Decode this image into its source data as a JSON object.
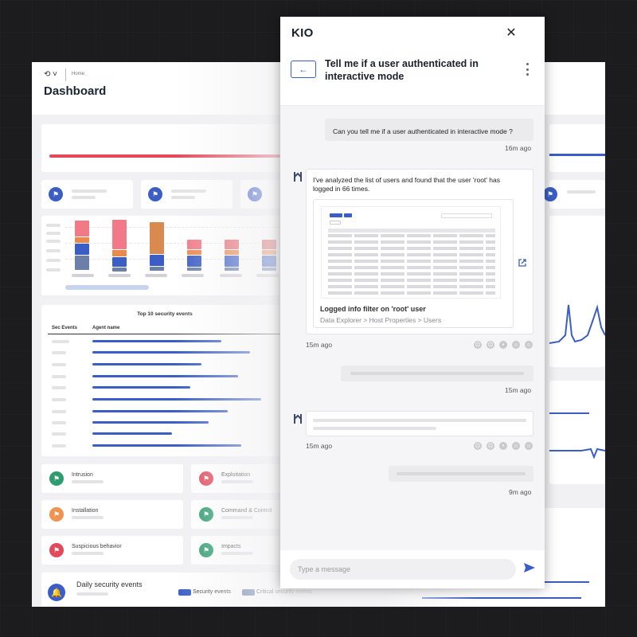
{
  "dashboard": {
    "breadcrumb": "Home",
    "title": "Dashboard",
    "top_events_title": "Top 10 security events",
    "col_sec_events": "Sec Events",
    "col_agent_name": "Agent name",
    "categories": [
      {
        "name": "Intrusion",
        "color": "#2e9c6e"
      },
      {
        "name": "Exploitation",
        "color": "#e24a5c"
      },
      {
        "name": "Installation",
        "color": "#ef9350"
      },
      {
        "name": "Command & Control",
        "color": "#2e9c6e"
      },
      {
        "name": "Suspicious behavior",
        "color": "#e24a5c"
      },
      {
        "name": "Impacts",
        "color": "#2e9c6e"
      }
    ],
    "daily_title": "Daily security events",
    "legend": [
      "Security events",
      "Critical security events"
    ],
    "legend_colors": [
      "#3b5ec6",
      "#6b7fa8"
    ]
  },
  "chat": {
    "app_name": "KIO",
    "conversation_title": "Tell me if a user authenticated in interactive mode",
    "user_message": "Can you tell me if a user authenticated in interactive mode ?",
    "user_message_time": "16m ago",
    "bot_message": "I've analyzed the list of users and found that the user 'root' has logged in 66 times.",
    "preview_title": "Logged info filter on 'root' user",
    "preview_path": "Data Explorer > Host Properties > Users",
    "bot_message_time": "15m ago",
    "user_message2_time": "15m ago",
    "bot_message2_time": "15m ago",
    "user_message3_time": "9m ago",
    "input_placeholder": "Type a message",
    "accent": "#3b5ec6"
  }
}
